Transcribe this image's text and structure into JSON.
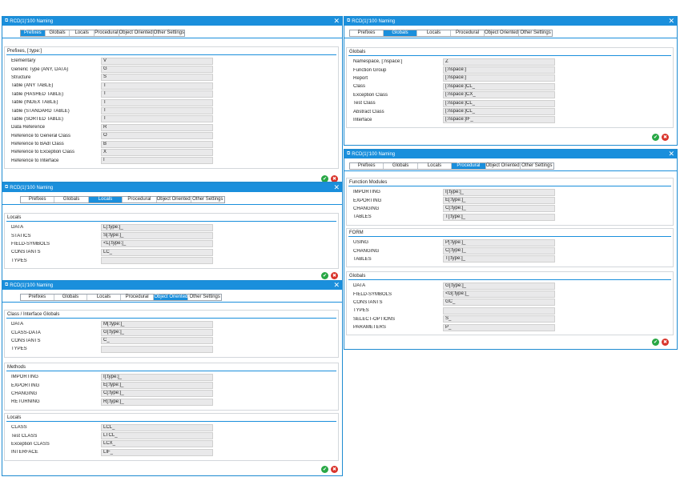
{
  "window_title": "RCD(1)'100 Naming",
  "tabs": [
    "Prefixes",
    "Globals",
    "Locals",
    "Procedural",
    "Object Oriented",
    "Other Settings"
  ],
  "prefixes": {
    "section_title": "Prefixes, [:type:]",
    "rows": [
      [
        "Elementary",
        "V"
      ],
      [
        "Generic Type (ANY, DATA)",
        "G"
      ],
      [
        "Structure",
        "S"
      ],
      [
        "Table (ANY TABLE)",
        "T"
      ],
      [
        "Table (HASHED TABLE)",
        "T"
      ],
      [
        "Table (INDEX TABLE)",
        "T"
      ],
      [
        "Table (STANDARD TABLE)",
        "T"
      ],
      [
        "Table (SORTED TABLE)",
        "T"
      ],
      [
        "Data Reference",
        "R"
      ],
      [
        "Reference to General Class",
        "O"
      ],
      [
        "Reference to BAdI Class",
        "B"
      ],
      [
        "Reference to Exception Class",
        "X"
      ],
      [
        "Reference to Interface",
        "I"
      ]
    ]
  },
  "globals": {
    "section_title": "Globals",
    "rows": [
      [
        "Namespace, [:nspace:]",
        "Z"
      ],
      [
        "Function Group",
        "[:nspace:]"
      ],
      [
        "Report",
        "[:nspace:]"
      ],
      [
        "Class",
        "[:nspace:]CL_"
      ],
      [
        "Exception Class",
        "[:nspace:]CX_"
      ],
      [
        "Test Class",
        "[:nspace:]CL_"
      ],
      [
        "Abstract Class",
        "[:nspace:]CL_"
      ],
      [
        "Interface",
        "[:nspace:]IF_"
      ]
    ]
  },
  "locals": {
    "section_title": "Locals",
    "rows": [
      [
        "DATA",
        "L[:type:]_"
      ],
      [
        "STATICS",
        "S[:type:]_"
      ],
      [
        "FIELD-SYMBOLS",
        "<L[:type:]_"
      ],
      [
        "CONSTANTS",
        "LC_"
      ],
      [
        "TYPES",
        ""
      ]
    ]
  },
  "procedural": {
    "function_modules": {
      "section_title": "Function Modules",
      "rows": [
        [
          "IMPORTING",
          "I[:type:]_"
        ],
        [
          "EXPORTING",
          "E[:type:]_"
        ],
        [
          "CHANGING",
          "C[:type:]_"
        ],
        [
          "TABLES",
          "T[:type:]_"
        ]
      ]
    },
    "form": {
      "section_title": "FORM",
      "rows": [
        [
          "USING",
          "P[:type:]_"
        ],
        [
          "CHANGING",
          "C[:type:]_"
        ],
        [
          "TABLES",
          "T[:type:]_"
        ]
      ]
    },
    "globals": {
      "section_title": "Globals",
      "rows": [
        [
          "DATA",
          "G[:type:]_"
        ],
        [
          "FIELD-SYMBOLS",
          "<G[:type:]_"
        ],
        [
          "CONSTANTS",
          "GC_"
        ],
        [
          "TYPES",
          ""
        ],
        [
          "SELECT-OPTIONS",
          "S_"
        ],
        [
          "PARAMETERS",
          "P_"
        ]
      ]
    }
  },
  "object_oriented": {
    "class_globals": {
      "section_title": "Class / Interface Globals",
      "rows": [
        [
          "DATA",
          "M[:type:]_"
        ],
        [
          "CLASS-DATA",
          "G[:type:]_"
        ],
        [
          "CONSTANTS",
          "C_"
        ],
        [
          "TYPES",
          ""
        ]
      ]
    },
    "methods": {
      "section_title": "Methods",
      "rows": [
        [
          "IMPORTING",
          "I[:type:]_"
        ],
        [
          "EXPORTING",
          "E[:type:]_"
        ],
        [
          "CHANGING",
          "C[:type:]_"
        ],
        [
          "RETURNING",
          "R[:type:]_"
        ]
      ]
    },
    "locals": {
      "section_title": "Locals",
      "rows": [
        [
          "CLASS",
          "LCL_"
        ],
        [
          "Test CLASS",
          "LTCL_"
        ],
        [
          "Exception CLASS",
          "LCX_"
        ],
        [
          "INTERFACE",
          "LIF_"
        ]
      ]
    }
  },
  "icons": {
    "title": "window-icon",
    "close": "close-icon",
    "ok": "check-icon",
    "cancel": "cancel-icon"
  },
  "colors": {
    "accent": "#1a8fdc",
    "ok": "#28a745",
    "cancel": "#d9342b",
    "field_bg": "#e9e9ea"
  }
}
